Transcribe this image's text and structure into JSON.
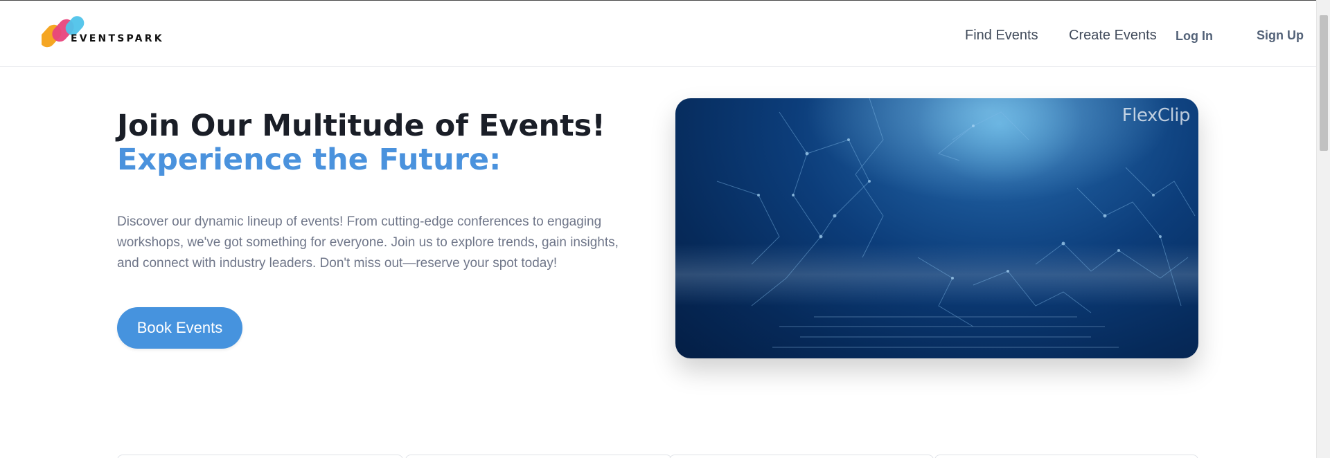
{
  "brand": {
    "name": "EVENTSPARK"
  },
  "nav": {
    "find_events": "Find Events",
    "create_events": "Create Events",
    "log_in": "Log In",
    "sign_up": "Sign Up"
  },
  "hero": {
    "title": "Join Our Multitude of Events!",
    "subtitle": "Experience the Future:",
    "description": "Discover our dynamic lineup of events! From cutting-edge conferences to engaging workshops, we've got something for everyone. Join us to explore trends, gain insights, and connect with industry leaders. Don't miss out—reserve your spot today!",
    "button_label": "Book Events",
    "media_watermark": "FlexClip"
  },
  "colors": {
    "accent": "#4693de",
    "heading": "#1a1e27",
    "subheading": "#4a92dd",
    "body_text": "#6f7689"
  },
  "icons": [
    "eventspark-logo-icon"
  ]
}
